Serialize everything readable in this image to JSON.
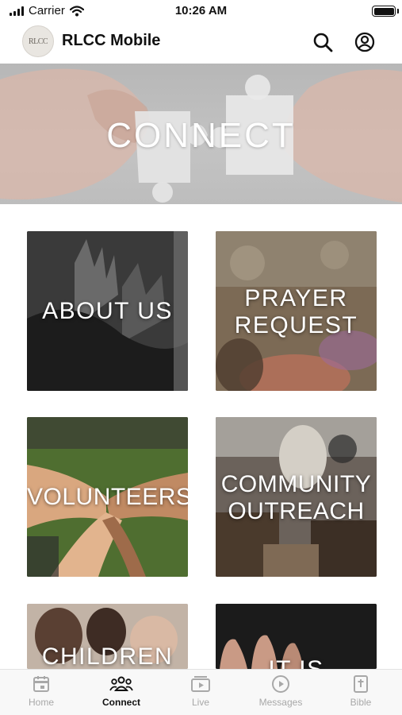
{
  "status_bar": {
    "carrier": "Carrier",
    "time": "10:26 AM"
  },
  "header": {
    "logo_text": "RLCC",
    "title": "RLCC Mobile"
  },
  "hero": {
    "title": "CONNECT"
  },
  "tiles": [
    {
      "line1": "ABOUT US",
      "line2": ""
    },
    {
      "line1": "PRAYER",
      "line2": "REQUEST"
    },
    {
      "line1": "VOLUNTEERS",
      "line2": ""
    },
    {
      "line1": "COMMUNITY",
      "line2": "OUTREACH"
    },
    {
      "line1": "CHILDREN",
      "line2": ""
    },
    {
      "line1": "IT IS",
      "line2": ""
    }
  ],
  "tab_bar": {
    "active": "Connect",
    "tabs": [
      {
        "label": "Home",
        "icon": "calendar-icon"
      },
      {
        "label": "Connect",
        "icon": "people-icon"
      },
      {
        "label": "Live",
        "icon": "live-video-icon"
      },
      {
        "label": "Messages",
        "icon": "play-circle-icon"
      },
      {
        "label": "Bible",
        "icon": "bible-icon"
      }
    ]
  },
  "colors": {
    "accent": "#111111",
    "inactive_tab": "#a8a8a8",
    "hero_overlay": "#bdbdbd"
  }
}
